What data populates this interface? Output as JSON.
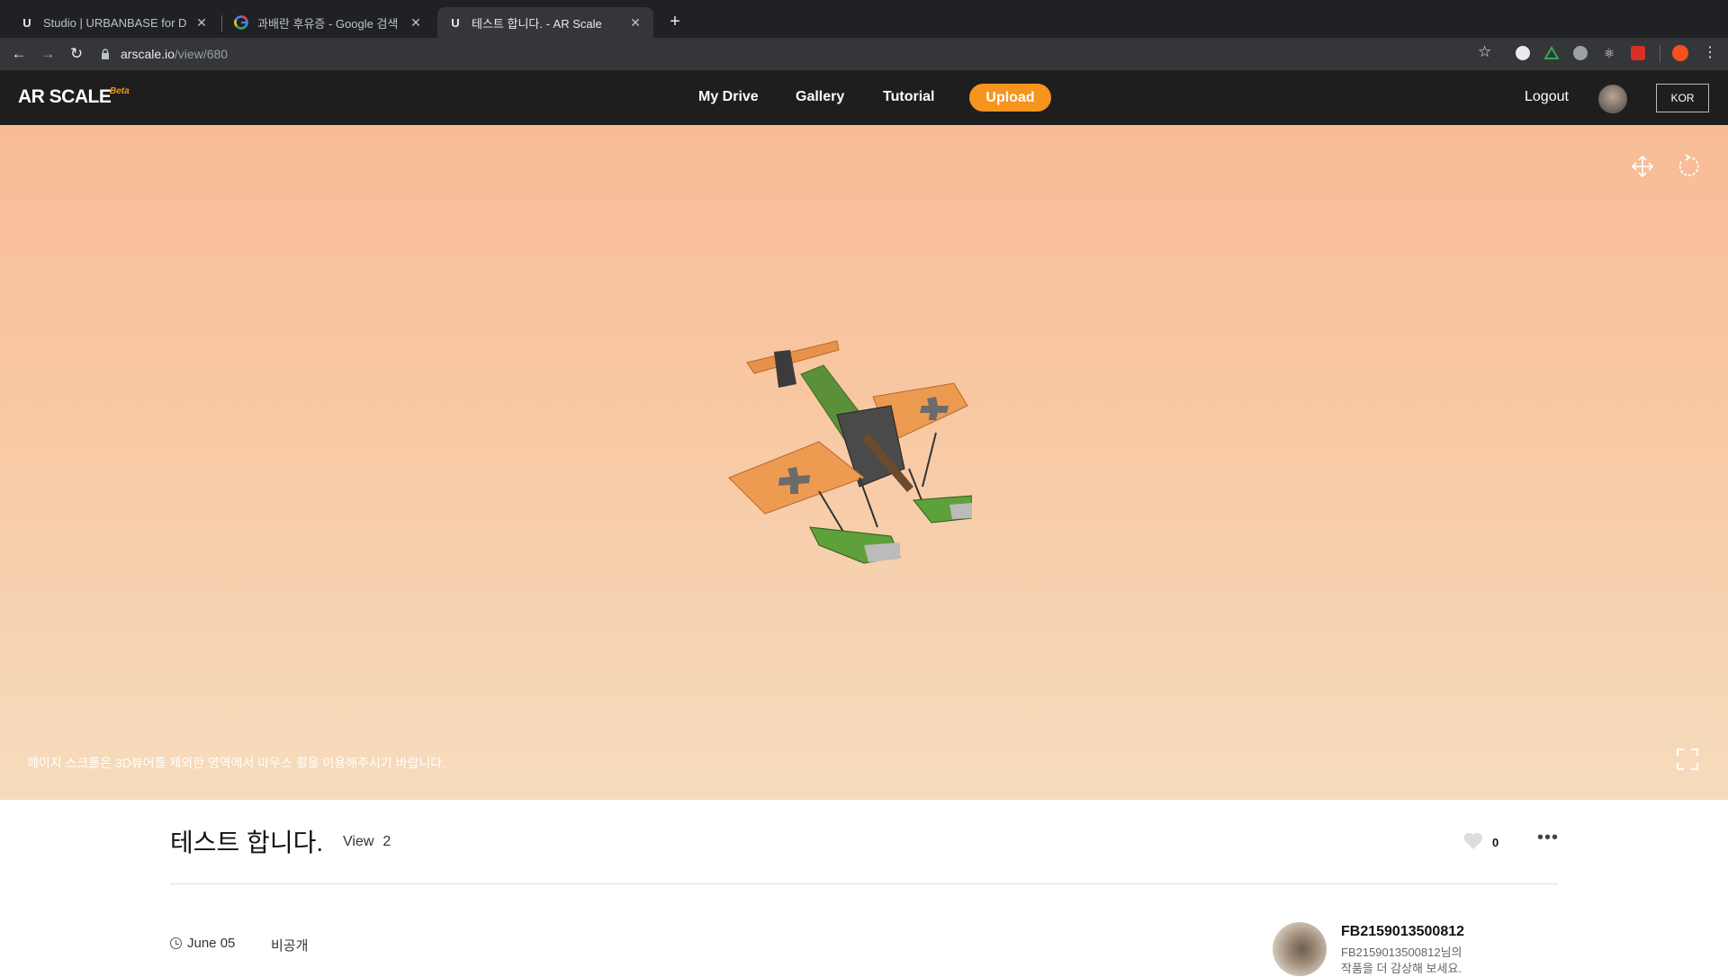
{
  "browser": {
    "tabs": [
      {
        "title": "Studio | URBANBASE for Devel",
        "favicon": "U"
      },
      {
        "title": "과배란 후유증 - Google 검색",
        "favicon": "google-icon"
      },
      {
        "title": "테스트 합니다. - AR Scale",
        "favicon": "U"
      }
    ],
    "url_host": "arscale.io",
    "url_path": "/view/680"
  },
  "header": {
    "logo": "AR SCALE",
    "logo_badge": "Beta",
    "nav": [
      "My Drive",
      "Gallery",
      "Tutorial"
    ],
    "upload_label": "Upload",
    "logout_label": "Logout",
    "lang_label": "KOR",
    "accent_color": "#f7941d"
  },
  "viewer": {
    "hint": "페이지 스크롤은 3D뷰어를 제외한 영역에서 마우스 휠을 이용해주시기 바랍니다.",
    "icons": [
      "move-icon",
      "rotate-icon",
      "fullscreen-icon"
    ]
  },
  "item": {
    "title": "테스트 합니다.",
    "view_label": "View",
    "view_count": "2",
    "like_count": "0",
    "date": "June 05",
    "visibility": "비공개"
  },
  "owner": {
    "name": "FB2159013500812",
    "desc": "FB2159013500812님의 작품을 더 감상해 보세요."
  }
}
